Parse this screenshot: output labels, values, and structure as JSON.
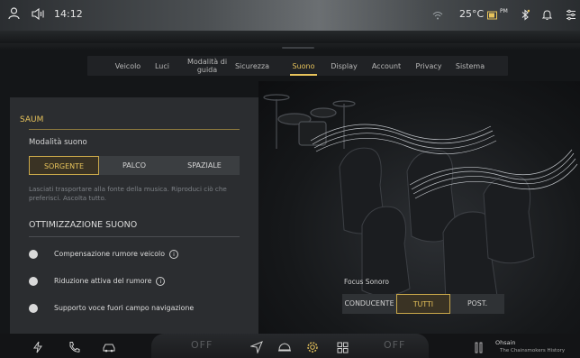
{
  "status_bar": {
    "time": "14:12",
    "temperature": "25°C",
    "badge": "PM",
    "icons": [
      "person-icon",
      "volume-icon",
      "wifi-icon",
      "battery-icon",
      "bluetooth-icon",
      "bell-icon",
      "settings-sliders-icon"
    ]
  },
  "tabs": [
    {
      "label": "Veicolo",
      "active": false
    },
    {
      "label": "Luci",
      "active": false
    },
    {
      "label": "Modalità di guida",
      "active": false
    },
    {
      "label": "Sicurezza",
      "active": false
    },
    {
      "label": "Suono",
      "active": true
    },
    {
      "label": "Display",
      "active": false
    },
    {
      "label": "Account",
      "active": false
    },
    {
      "label": "Privacy",
      "active": false
    },
    {
      "label": "Sistema",
      "active": false
    }
  ],
  "panel": {
    "section_title": "SAUM",
    "mode_label": "Modalità suono",
    "modes": [
      {
        "label": "SORGENTE",
        "selected": true
      },
      {
        "label": "PALCO",
        "selected": false
      },
      {
        "label": "SPAZIALE",
        "selected": false
      }
    ],
    "description": "Lasciati trasportare alla fonte della musica. Riproduci ciò che preferisci. Ascolta tutto.",
    "optimization_title": "OTTIMIZZAZIONE SUONO",
    "options": [
      {
        "label": "Compensazione rumore veicolo",
        "info": true
      },
      {
        "label": "Riduzione attiva del rumore",
        "info": true
      },
      {
        "label": "Supporto voce fuori campo navigazione",
        "info": false
      }
    ],
    "info_glyph": "i"
  },
  "focus": {
    "label": "Focus Sonoro",
    "options": [
      {
        "label": "CONDUCENTE",
        "selected": false
      },
      {
        "label": "TUTTI",
        "selected": true
      },
      {
        "label": "POST.",
        "selected": false
      }
    ]
  },
  "dock": {
    "left_off": "OFF",
    "right_off": "OFF",
    "media_title": "Ohsain",
    "media_subtitle": "The Chainsmokers History",
    "icons": [
      "bolt-icon",
      "phone-icon",
      "car-fan-icon",
      "navigation-arrow-icon",
      "car-icon",
      "settings-gear-icon",
      "grid-apps-icon",
      "pause-icon"
    ]
  },
  "colors": {
    "accent": "#e7c35b",
    "panel_bg": "#2b2d30",
    "segment_bg": "#3b3e41"
  }
}
